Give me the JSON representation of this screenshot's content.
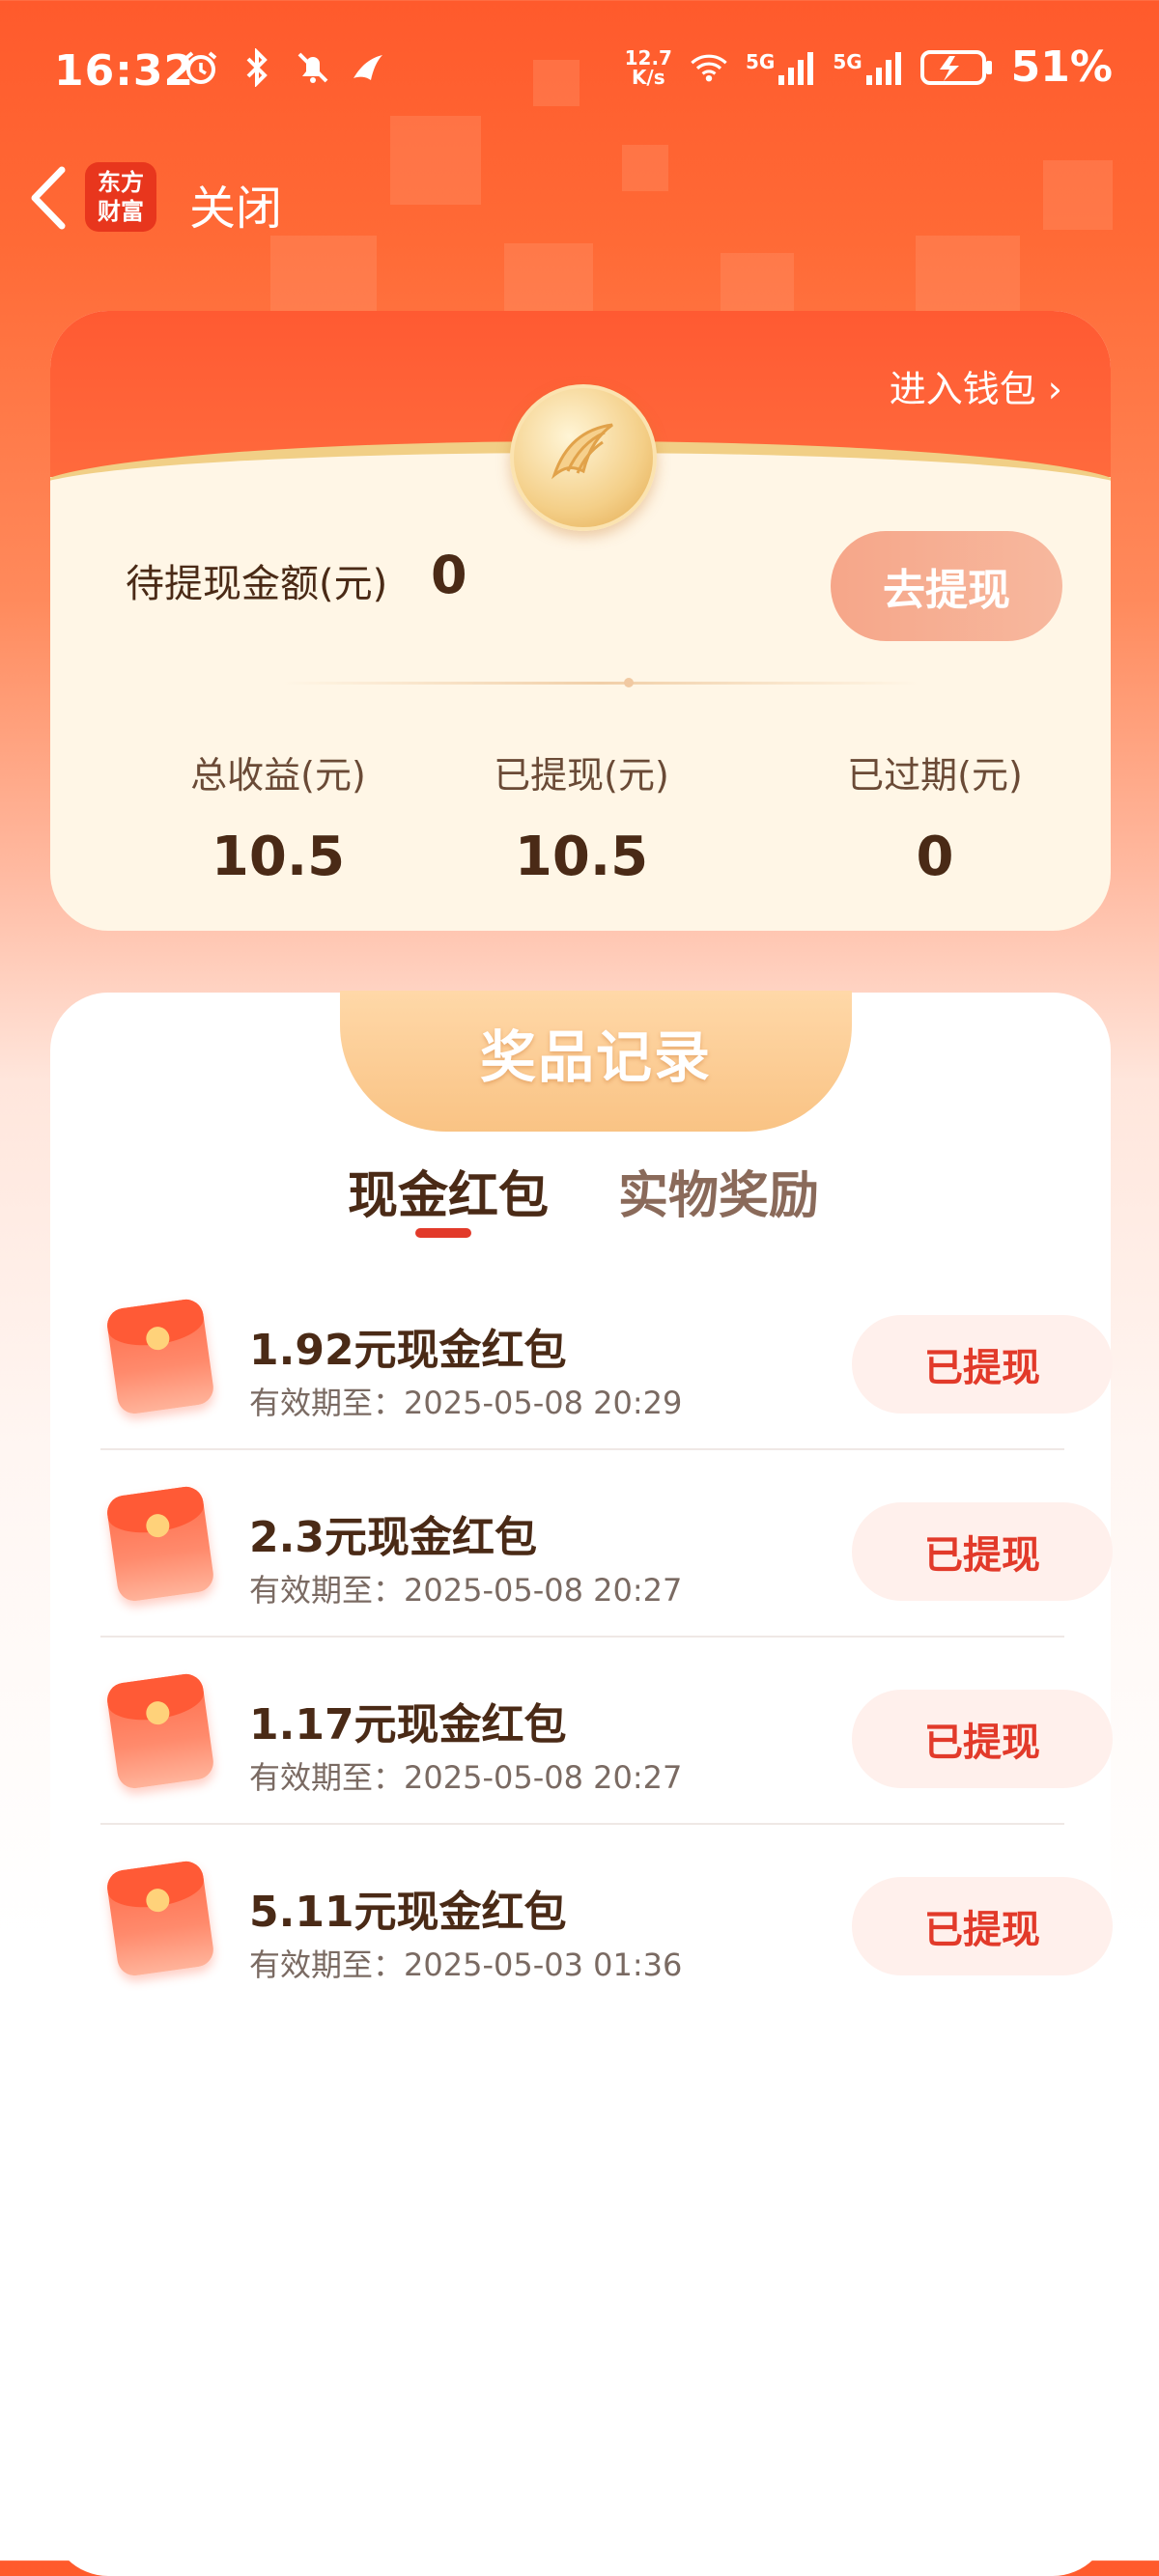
{
  "status_bar": {
    "time": "16:32",
    "speed_value": "12.7",
    "speed_unit": "K/s",
    "signal_1": "5G",
    "signal_2": "5G",
    "battery": "51%"
  },
  "nav": {
    "app_logo_line1": "东方",
    "app_logo_line2": "财富",
    "close_label": "关闭"
  },
  "wallet": {
    "enter_wallet": "进入钱包",
    "pending_label": "待提现金额(元)",
    "pending_value": "0",
    "withdraw_button": "去提现",
    "stats": [
      {
        "label": "总收益(元)",
        "value": "10.5"
      },
      {
        "label": "已提现(元)",
        "value": "10.5"
      },
      {
        "label": "已过期(元)",
        "value": "0"
      }
    ]
  },
  "rewards": {
    "title": "奖品记录",
    "tabs": [
      {
        "label": "现金红包",
        "active": true
      },
      {
        "label": "实物奖励",
        "active": false
      }
    ],
    "items": [
      {
        "title": "1.92元现金红包",
        "expiry": "有效期至：2025-05-08 20:29",
        "status": "已提现"
      },
      {
        "title": "2.3元现金红包",
        "expiry": "有效期至：2025-05-08 20:27",
        "status": "已提现"
      },
      {
        "title": "1.17元现金红包",
        "expiry": "有效期至：2025-05-08 20:27",
        "status": "已提现"
      },
      {
        "title": "5.11元现金红包",
        "expiry": "有效期至：2025-05-03 01:36",
        "status": "已提现"
      }
    ]
  },
  "colors": {
    "brand": "#ff5a2c",
    "accent_red": "#e23a2a",
    "text_dark": "#4a2a16",
    "gold": "#f4cf88"
  },
  "icons": [
    "back-arrow-icon",
    "alarm-icon",
    "bluetooth-icon",
    "mute-icon",
    "wifi-icon",
    "signal-icon",
    "battery-icon",
    "chevron-right-icon",
    "coin-icon",
    "red-envelope-icon"
  ]
}
